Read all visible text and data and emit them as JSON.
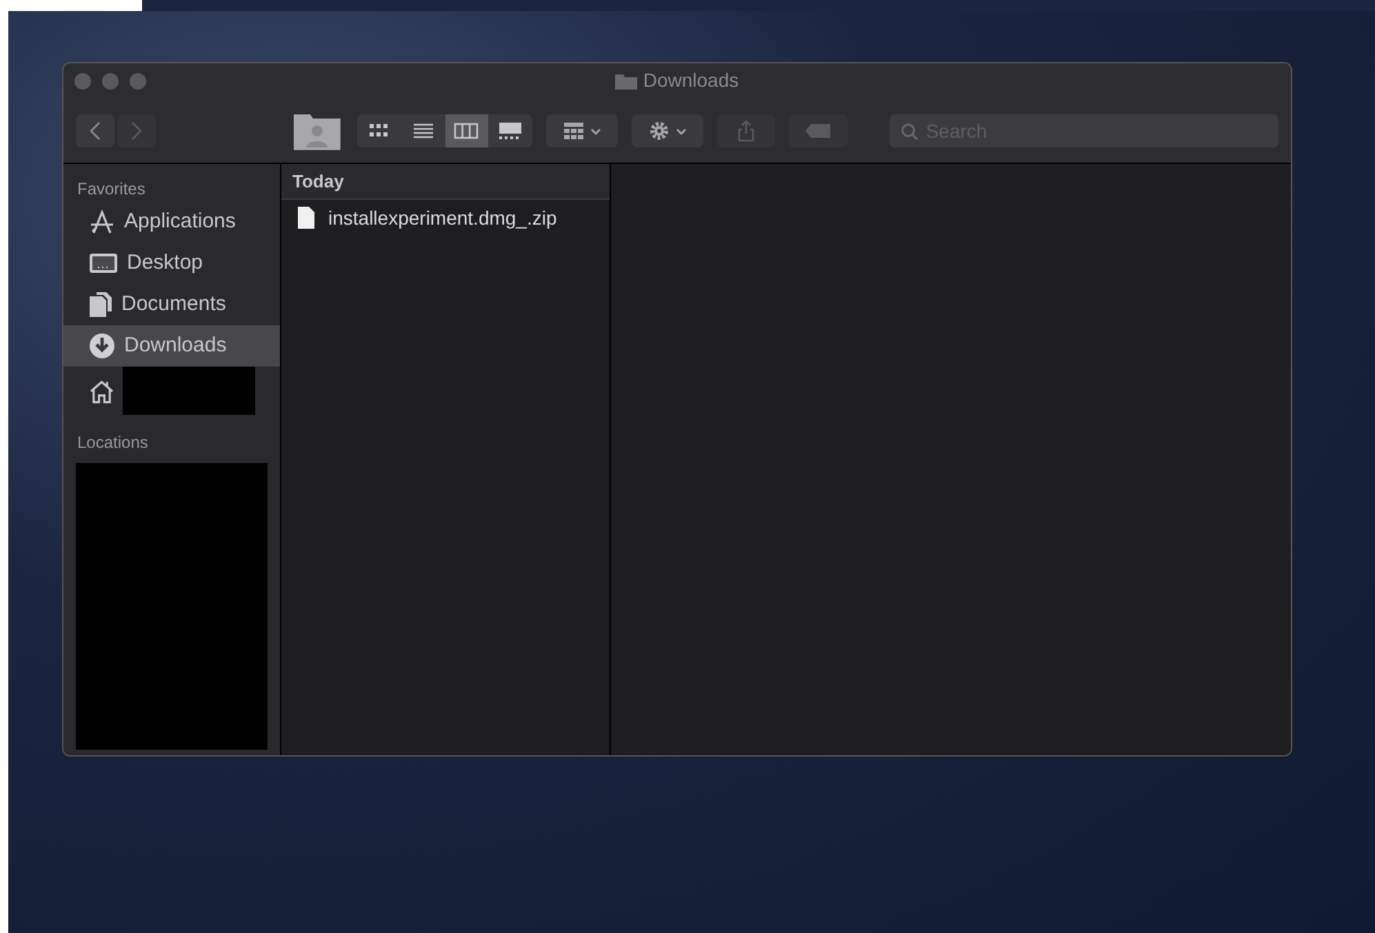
{
  "window": {
    "title": "Downloads"
  },
  "toolbar": {
    "view_modes": [
      {
        "kind": "icons",
        "selected": false
      },
      {
        "kind": "list",
        "selected": false
      },
      {
        "kind": "columns",
        "selected": true
      },
      {
        "kind": "gallery",
        "selected": false
      }
    ],
    "search": {
      "placeholder": "Search"
    }
  },
  "sidebar": {
    "sections": [
      {
        "title": "Favorites",
        "items": [
          {
            "kind": "applications",
            "label": "Applications",
            "selected": false
          },
          {
            "kind": "desktop",
            "label": "Desktop",
            "selected": false
          },
          {
            "kind": "documents",
            "label": "Documents",
            "selected": false
          },
          {
            "kind": "downloads",
            "label": "Downloads",
            "selected": true
          },
          {
            "kind": "home",
            "redacted": true,
            "selected": false
          }
        ]
      },
      {
        "title": "Locations",
        "redacted": true
      }
    ]
  },
  "column": {
    "header": "Today",
    "files": [
      {
        "name": "installexperiment.dmg_.zip"
      }
    ]
  }
}
